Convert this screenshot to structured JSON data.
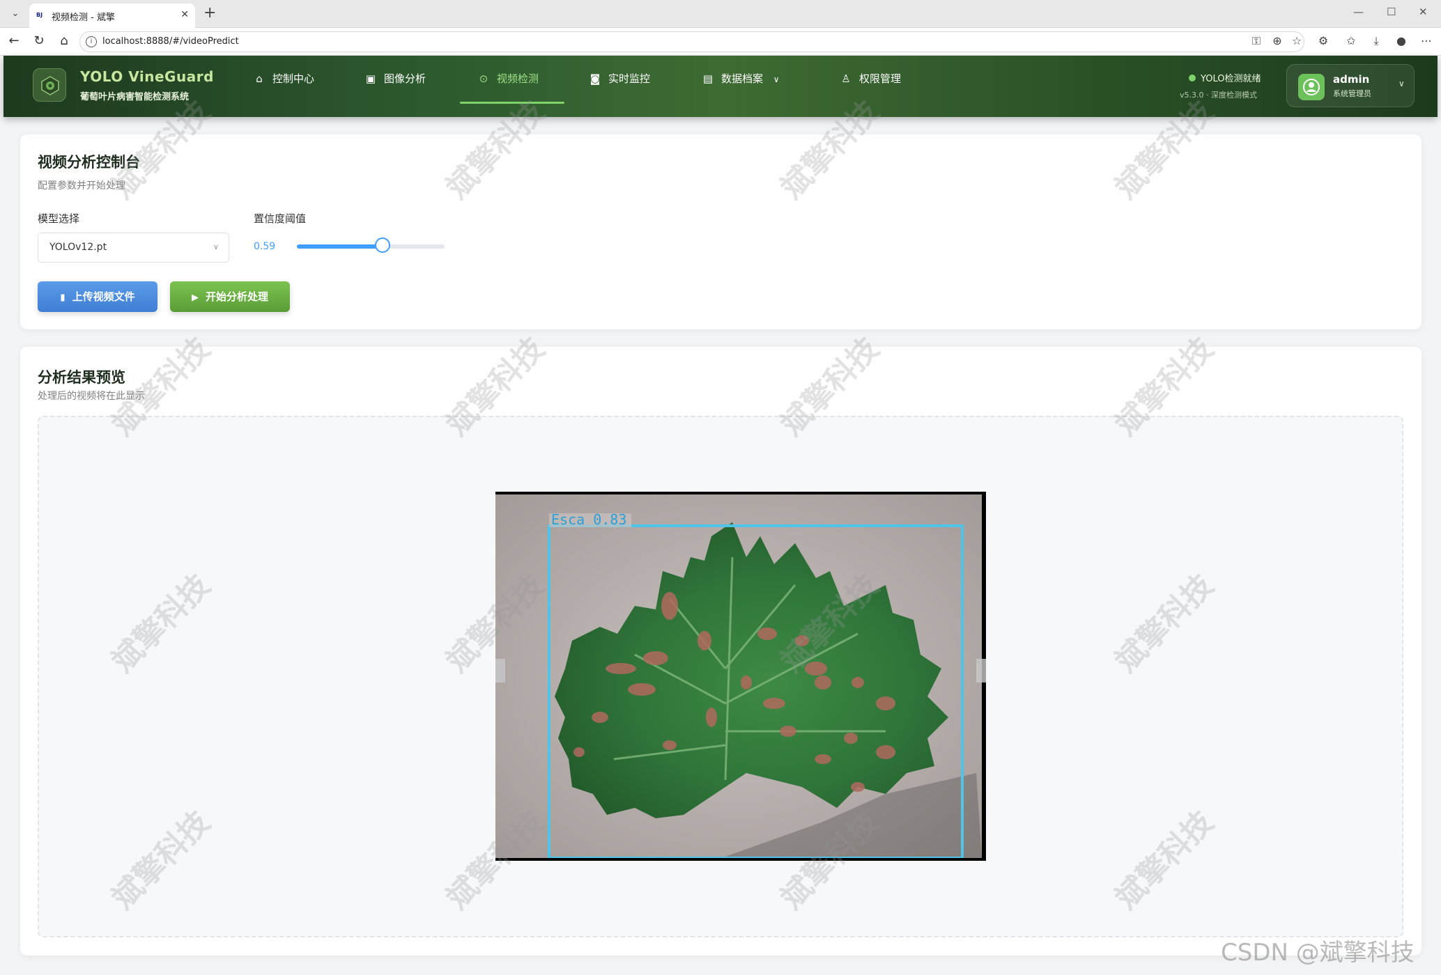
{
  "browser": {
    "tab_title": "视频检测 - 斌擎",
    "favicon_text": "BJ",
    "url": "localhost:8888/#/videoPredict"
  },
  "header": {
    "brand_title": "YOLO VineGuard",
    "brand_subtitle": "葡萄叶片病害智能检测系统",
    "nav": [
      {
        "label": "控制中心",
        "icon": "home-icon"
      },
      {
        "label": "图像分析",
        "icon": "image-icon"
      },
      {
        "label": "视频检测",
        "icon": "play-circle-icon",
        "active": true
      },
      {
        "label": "实时监控",
        "icon": "camera-icon"
      },
      {
        "label": "数据档案",
        "icon": "document-icon"
      },
      {
        "label": "权限管理",
        "icon": "user-icon"
      }
    ],
    "status_text": "YOLO检测就绪",
    "status_version": "v5.3.0 · 深度检测模式",
    "user_name": "admin",
    "user_role": "系统管理员"
  },
  "control_panel": {
    "title": "视频分析控制台",
    "subtitle": "配置参数并开始处理",
    "model_label": "模型选择",
    "model_value": "YOLOv12.pt",
    "confidence_label": "置信度阈值",
    "confidence_value": "0.59",
    "confidence_fraction": 0.59,
    "upload_label": "上传视频文件",
    "start_label": "开始分析处理"
  },
  "preview": {
    "title": "分析结果预览",
    "subtitle": "处理后的视频将在此显示",
    "detection_label": "Esca 0.83"
  },
  "watermark": "斌擎科技",
  "csdn_mark": "CSDN @斌擎科技",
  "colors": {
    "accent_blue": "#409eff",
    "accent_green": "#7ed36a",
    "header_dark": "#2d5a2e",
    "bbox": "#4fc3e8"
  }
}
